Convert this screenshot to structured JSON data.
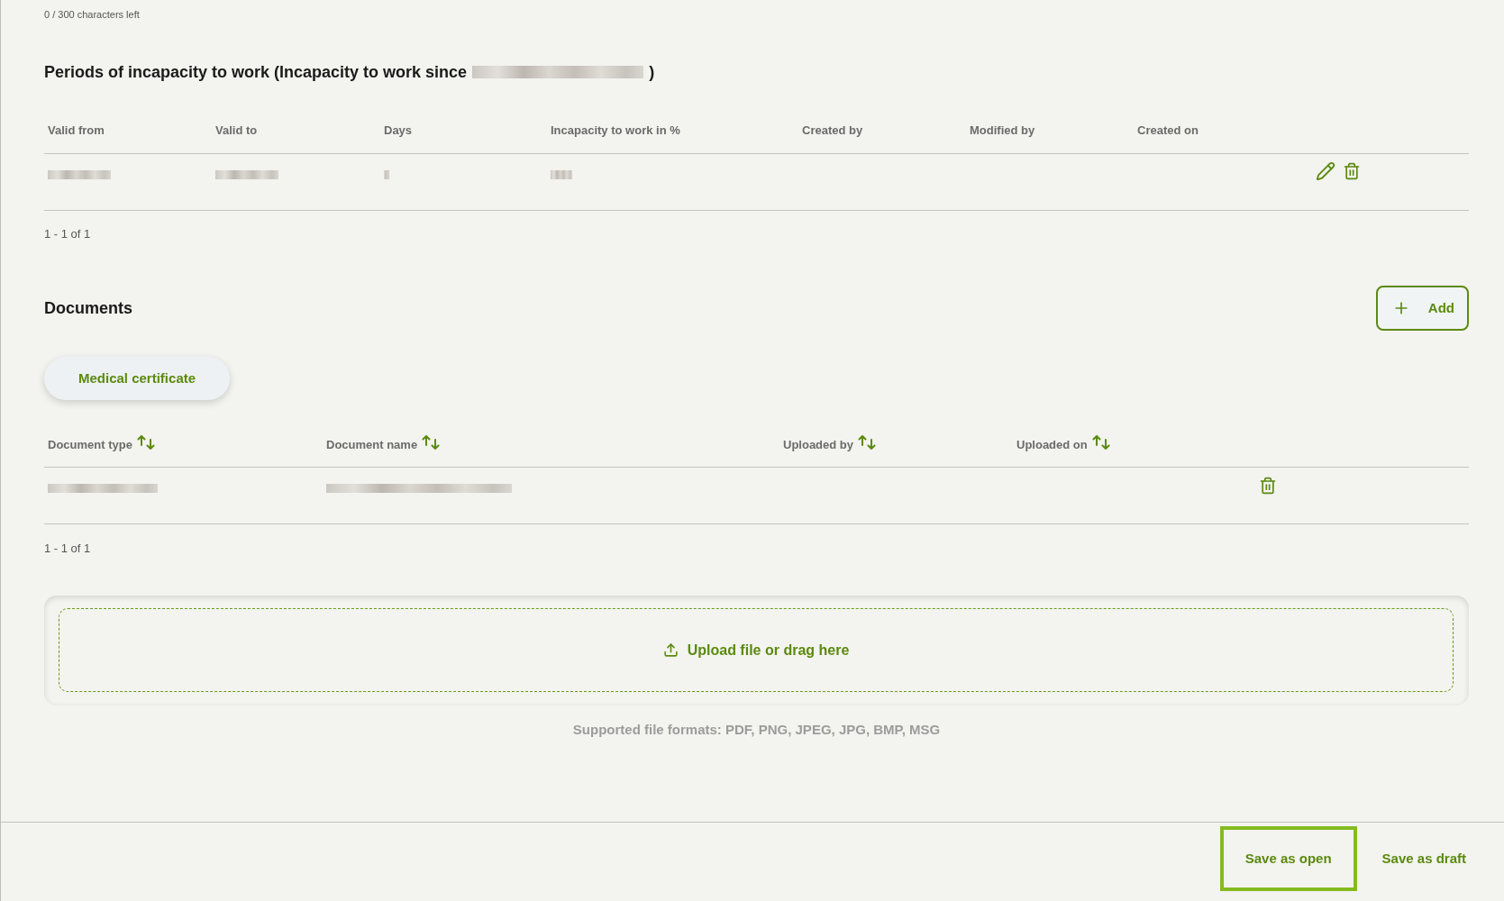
{
  "comment_counter": "0 / 300 characters left",
  "periods": {
    "title": {
      "text": "Periods of incapacity to work (Incapacity to work since",
      "redacted_part": true,
      "closing": ")"
    },
    "columns": [
      "Valid from",
      "Valid to",
      "Days",
      "Incapacity to work in %",
      "Created by",
      "Modified by",
      "Created on"
    ],
    "rows": [
      {
        "cells": [
          {
            "kind": "redacted"
          },
          {
            "kind": "redacted"
          },
          {
            "kind": "redacted"
          },
          {
            "kind": "redacted"
          }
        ]
      }
    ],
    "pagination": "1 - 1 of 1"
  },
  "documents": {
    "title": "Documents",
    "add_button": "Add",
    "filters": [
      {
        "label": "Medical certificate",
        "selected": true
      }
    ],
    "columns": [
      {
        "label": "Document type",
        "sortable": true
      },
      {
        "label": "Document name",
        "sortable": true
      },
      {
        "label": "Uploaded by",
        "sortable": true
      },
      {
        "label": "Uploaded on",
        "sortable": true
      }
    ],
    "rows": [
      {
        "cells": [
          {
            "kind": "redacted"
          },
          {
            "kind": "redacted"
          }
        ]
      }
    ],
    "pagination": "1 - 1 of 1",
    "upload": {
      "label": "Upload file or drag here",
      "hint": "Supported file formats: PDF, PNG, JPEG, JPG, BMP, MSG"
    }
  },
  "footer": {
    "buttons": [
      {
        "label": "Save as open",
        "focused": true
      },
      {
        "label": "Save as draft",
        "focused": false
      }
    ]
  }
}
